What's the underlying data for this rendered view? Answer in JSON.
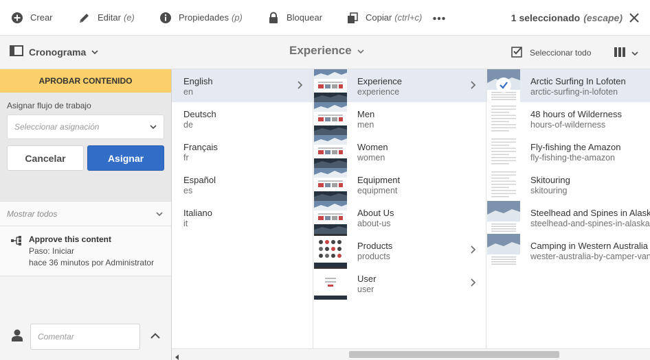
{
  "actionbar": {
    "create": {
      "label": "Crear",
      "icon": "plus-circle-icon"
    },
    "edit": {
      "label": "Editar",
      "shortcut": "(e)",
      "icon": "pencil-icon"
    },
    "properties": {
      "label": "Propiedades",
      "shortcut": "(p)",
      "icon": "info-icon"
    },
    "lock": {
      "label": "Bloquear",
      "icon": "lock-icon"
    },
    "copy": {
      "label": "Copiar",
      "shortcut": "(ctrl+c)",
      "icon": "copy-icon"
    },
    "more_icon": "ellipsis-icon",
    "selection": {
      "label": "1 seleccionado",
      "shortcut": "(escape)"
    },
    "close_icon": "close-icon"
  },
  "toolbar": {
    "rail_label": "Cronograma",
    "breadcrumb": "Experience",
    "select_all": "Seleccionar todo",
    "view_icon": "column-view-icon"
  },
  "rail": {
    "header": "APROBAR CONTENIDO",
    "assign_label": "Asignar flujo de trabajo",
    "assign_placeholder": "Seleccionar asignación",
    "cancel": "Cancelar",
    "assign": "Asignar",
    "show_all": "Mostrar todos",
    "timeline": {
      "title": "Approve this content",
      "step": "Paso: Iniciar",
      "meta": "hace 36 minutos por Administrator"
    },
    "comment_placeholder": "Comentar"
  },
  "columns": {
    "languages": [
      {
        "title": "English",
        "name": "en",
        "active": true,
        "has_children": true
      },
      {
        "title": "Deutsch",
        "name": "de"
      },
      {
        "title": "Français",
        "name": "fr"
      },
      {
        "title": "Español",
        "name": "es"
      },
      {
        "title": "Italiano",
        "name": "it"
      }
    ],
    "sections": [
      {
        "title": "Experience",
        "name": "experience",
        "active": true,
        "has_children": true
      },
      {
        "title": "Men",
        "name": "men"
      },
      {
        "title": "Women",
        "name": "women"
      },
      {
        "title": "Equipment",
        "name": "equipment"
      },
      {
        "title": "About Us",
        "name": "about-us"
      },
      {
        "title": "Products",
        "name": "products",
        "has_children": true
      },
      {
        "title": "User",
        "name": "user",
        "has_children": true
      }
    ],
    "pages": [
      {
        "title": "Arctic Surfing In Lofoten",
        "name": "arctic-surfing-in-lofoten",
        "selected": true
      },
      {
        "title": "48 hours of Wilderness",
        "name": "hours-of-wilderness"
      },
      {
        "title": "Fly-fishing the Amazon",
        "name": "fly-fishing-the-amazon"
      },
      {
        "title": "Skitouring",
        "name": "skitouring"
      },
      {
        "title": "Steelhead and Spines in Alaska",
        "name": "steelhead-and-spines-in-alaska"
      },
      {
        "title": "Camping in Western Australia",
        "name": "wester-australia-by-camper-van"
      }
    ]
  },
  "colors": {
    "accent": "#326ec8",
    "header_bg": "#fbd06a",
    "active_row": "#e4e9f2"
  }
}
